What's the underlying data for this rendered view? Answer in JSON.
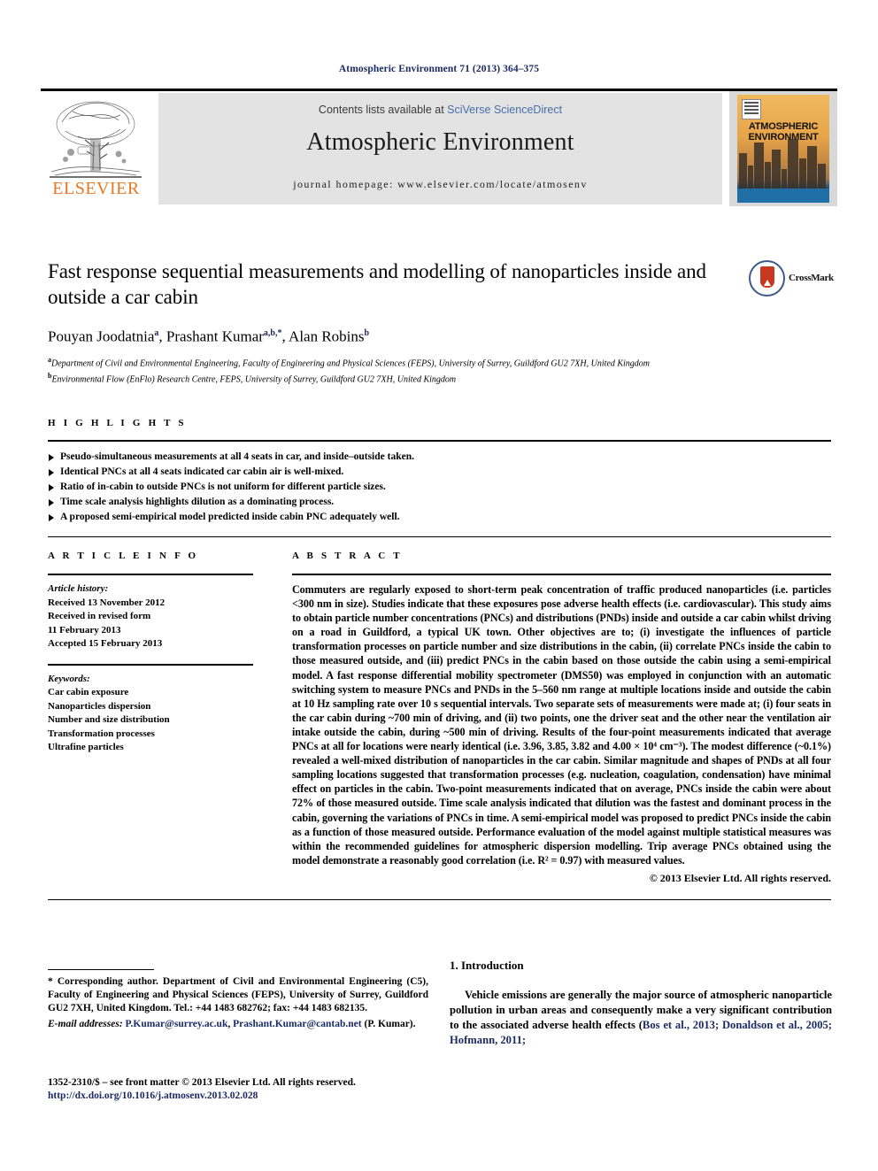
{
  "running_head": "Atmospheric Environment 71 (2013) 364–375",
  "masthead": {
    "contents_prefix": "Contents lists available at ",
    "sciencedirect": "SciVerse ScienceDirect",
    "journal_title": "Atmospheric Environment",
    "homepage": "journal homepage: www.elsevier.com/locate/atmosenv",
    "publisher_logo_text": "ELSEVIER",
    "cover_title_line1": "ATMOSPHERIC",
    "cover_title_line2": "ENVIRONMENT"
  },
  "article": {
    "title": "Fast response sequential measurements and modelling of nanoparticles inside and outside a car cabin",
    "authors_html": "Pouyan Joodatnia <sup>a</sup>, Prashant Kumar <sup>a,b,</sup><sup>*</sup>, Alan Robins <sup>b</sup>",
    "affiliation_a": "Department of Civil and Environmental Engineering, Faculty of Engineering and Physical Sciences (FEPS), University of Surrey, Guildford GU2 7XH, United Kingdom",
    "affiliation_b": "Environmental Flow (EnFlo) Research Centre, FEPS, University of Surrey, Guildford GU2 7XH, United Kingdom",
    "crossmark_label": "CrossMark"
  },
  "highlights": {
    "heading": "H I G H L I G H T S",
    "items": [
      "Pseudo-simultaneous measurements at all 4 seats in car, and inside–outside taken.",
      "Identical PNCs at all 4 seats indicated car cabin air is well-mixed.",
      "Ratio of in-cabin to outside PNCs is not uniform for different particle sizes.",
      "Time scale analysis highlights dilution as a dominating process.",
      "A proposed semi-empirical model predicted inside cabin PNC adequately well."
    ]
  },
  "article_info": {
    "heading": "A R T I C L E  I N F O",
    "history_label": "Article history:",
    "history_lines": [
      "Received 13 November 2012",
      "Received in revised form",
      "11 February 2013",
      "Accepted 15 February 2013"
    ],
    "keywords_label": "Keywords:",
    "keywords": [
      "Car cabin exposure",
      "Nanoparticles dispersion",
      "Number and size distribution",
      "Transformation processes",
      "Ultrafine particles"
    ]
  },
  "abstract": {
    "heading": "A B S T R A C T",
    "body": "Commuters are regularly exposed to short-term peak concentration of traffic produced nanoparticles (i.e. particles <300 nm in size). Studies indicate that these exposures pose adverse health effects (i.e. cardiovascular). This study aims to obtain particle number concentrations (PNCs) and distributions (PNDs) inside and outside a car cabin whilst driving on a road in Guildford, a typical UK town. Other objectives are to; (i) investigate the influences of particle transformation processes on particle number and size distributions in the cabin, (ii) correlate PNCs inside the cabin to those measured outside, and (iii) predict PNCs in the cabin based on those outside the cabin using a semi-empirical model. A fast response differential mobility spectrometer (DMS50) was employed in conjunction with an automatic switching system to measure PNCs and PNDs in the 5–560 nm range at multiple locations inside and outside the cabin at 10 Hz sampling rate over 10 s sequential intervals. Two separate sets of measurements were made at; (i) four seats in the car cabin during ~700 min of driving, and (ii) two points, one the driver seat and the other near the ventilation air intake outside the cabin, during ~500 min of driving. Results of the four-point measurements indicated that average PNCs at all for locations were nearly identical (i.e. 3.96, 3.85, 3.82 and 4.00 × 10⁴ cm⁻³). The modest difference (~0.1%) revealed a well-mixed distribution of nanoparticles in the car cabin. Similar magnitude and shapes of PNDs at all four sampling locations suggested that transformation processes (e.g. nucleation, coagulation, condensation) have minimal effect on particles in the cabin. Two-point measurements indicated that on average, PNCs inside the cabin were about 72% of those measured outside. Time scale analysis indicated that dilution was the fastest and dominant process in the cabin, governing the variations of PNCs in time. A semi-empirical model was proposed to predict PNCs inside the cabin as a function of those measured outside. Performance evaluation of the model against multiple statistical measures was within the recommended guidelines for atmospheric dispersion modelling. Trip average PNCs obtained using the model demonstrate a reasonably good correlation (i.e. R² = 0.97) with measured values.",
    "copyright": "© 2013 Elsevier Ltd. All rights reserved."
  },
  "footnotes": {
    "corresponding": "* Corresponding author. Department of Civil and Environmental Engineering (C5), Faculty of Engineering and Physical Sciences (FEPS), University of Surrey, Guildford GU2 7XH, United Kingdom. Tel.: +44 1483 682762; fax: +44 1483 682135.",
    "email_label": "E-mail addresses:",
    "email_1": "P.Kumar@surrey.ac.uk",
    "email_2": "Prashant.Kumar@cantab.net",
    "email_attrib": "(P. Kumar).",
    "issn_line": "1352-2310/$ – see front matter © 2013 Elsevier Ltd. All rights reserved.",
    "doi_line": "http://dx.doi.org/10.1016/j.atmosenv.2013.02.028"
  },
  "introduction": {
    "heading": "1. Introduction",
    "paragraph_prefix": "Vehicle emissions are generally the major source of atmospheric nanoparticle pollution in urban areas and consequently make a very significant contribution to the associated adverse health effects (",
    "citations": "Bos et al., 2013; Donaldson et al., 2005; Hofmann, 2011;"
  },
  "colors": {
    "navy": "#1b2a63",
    "elsevier_orange": "#E87722",
    "sciencedirect_blue": "#4a6ea9",
    "band_grey": "#e3e3e3"
  }
}
